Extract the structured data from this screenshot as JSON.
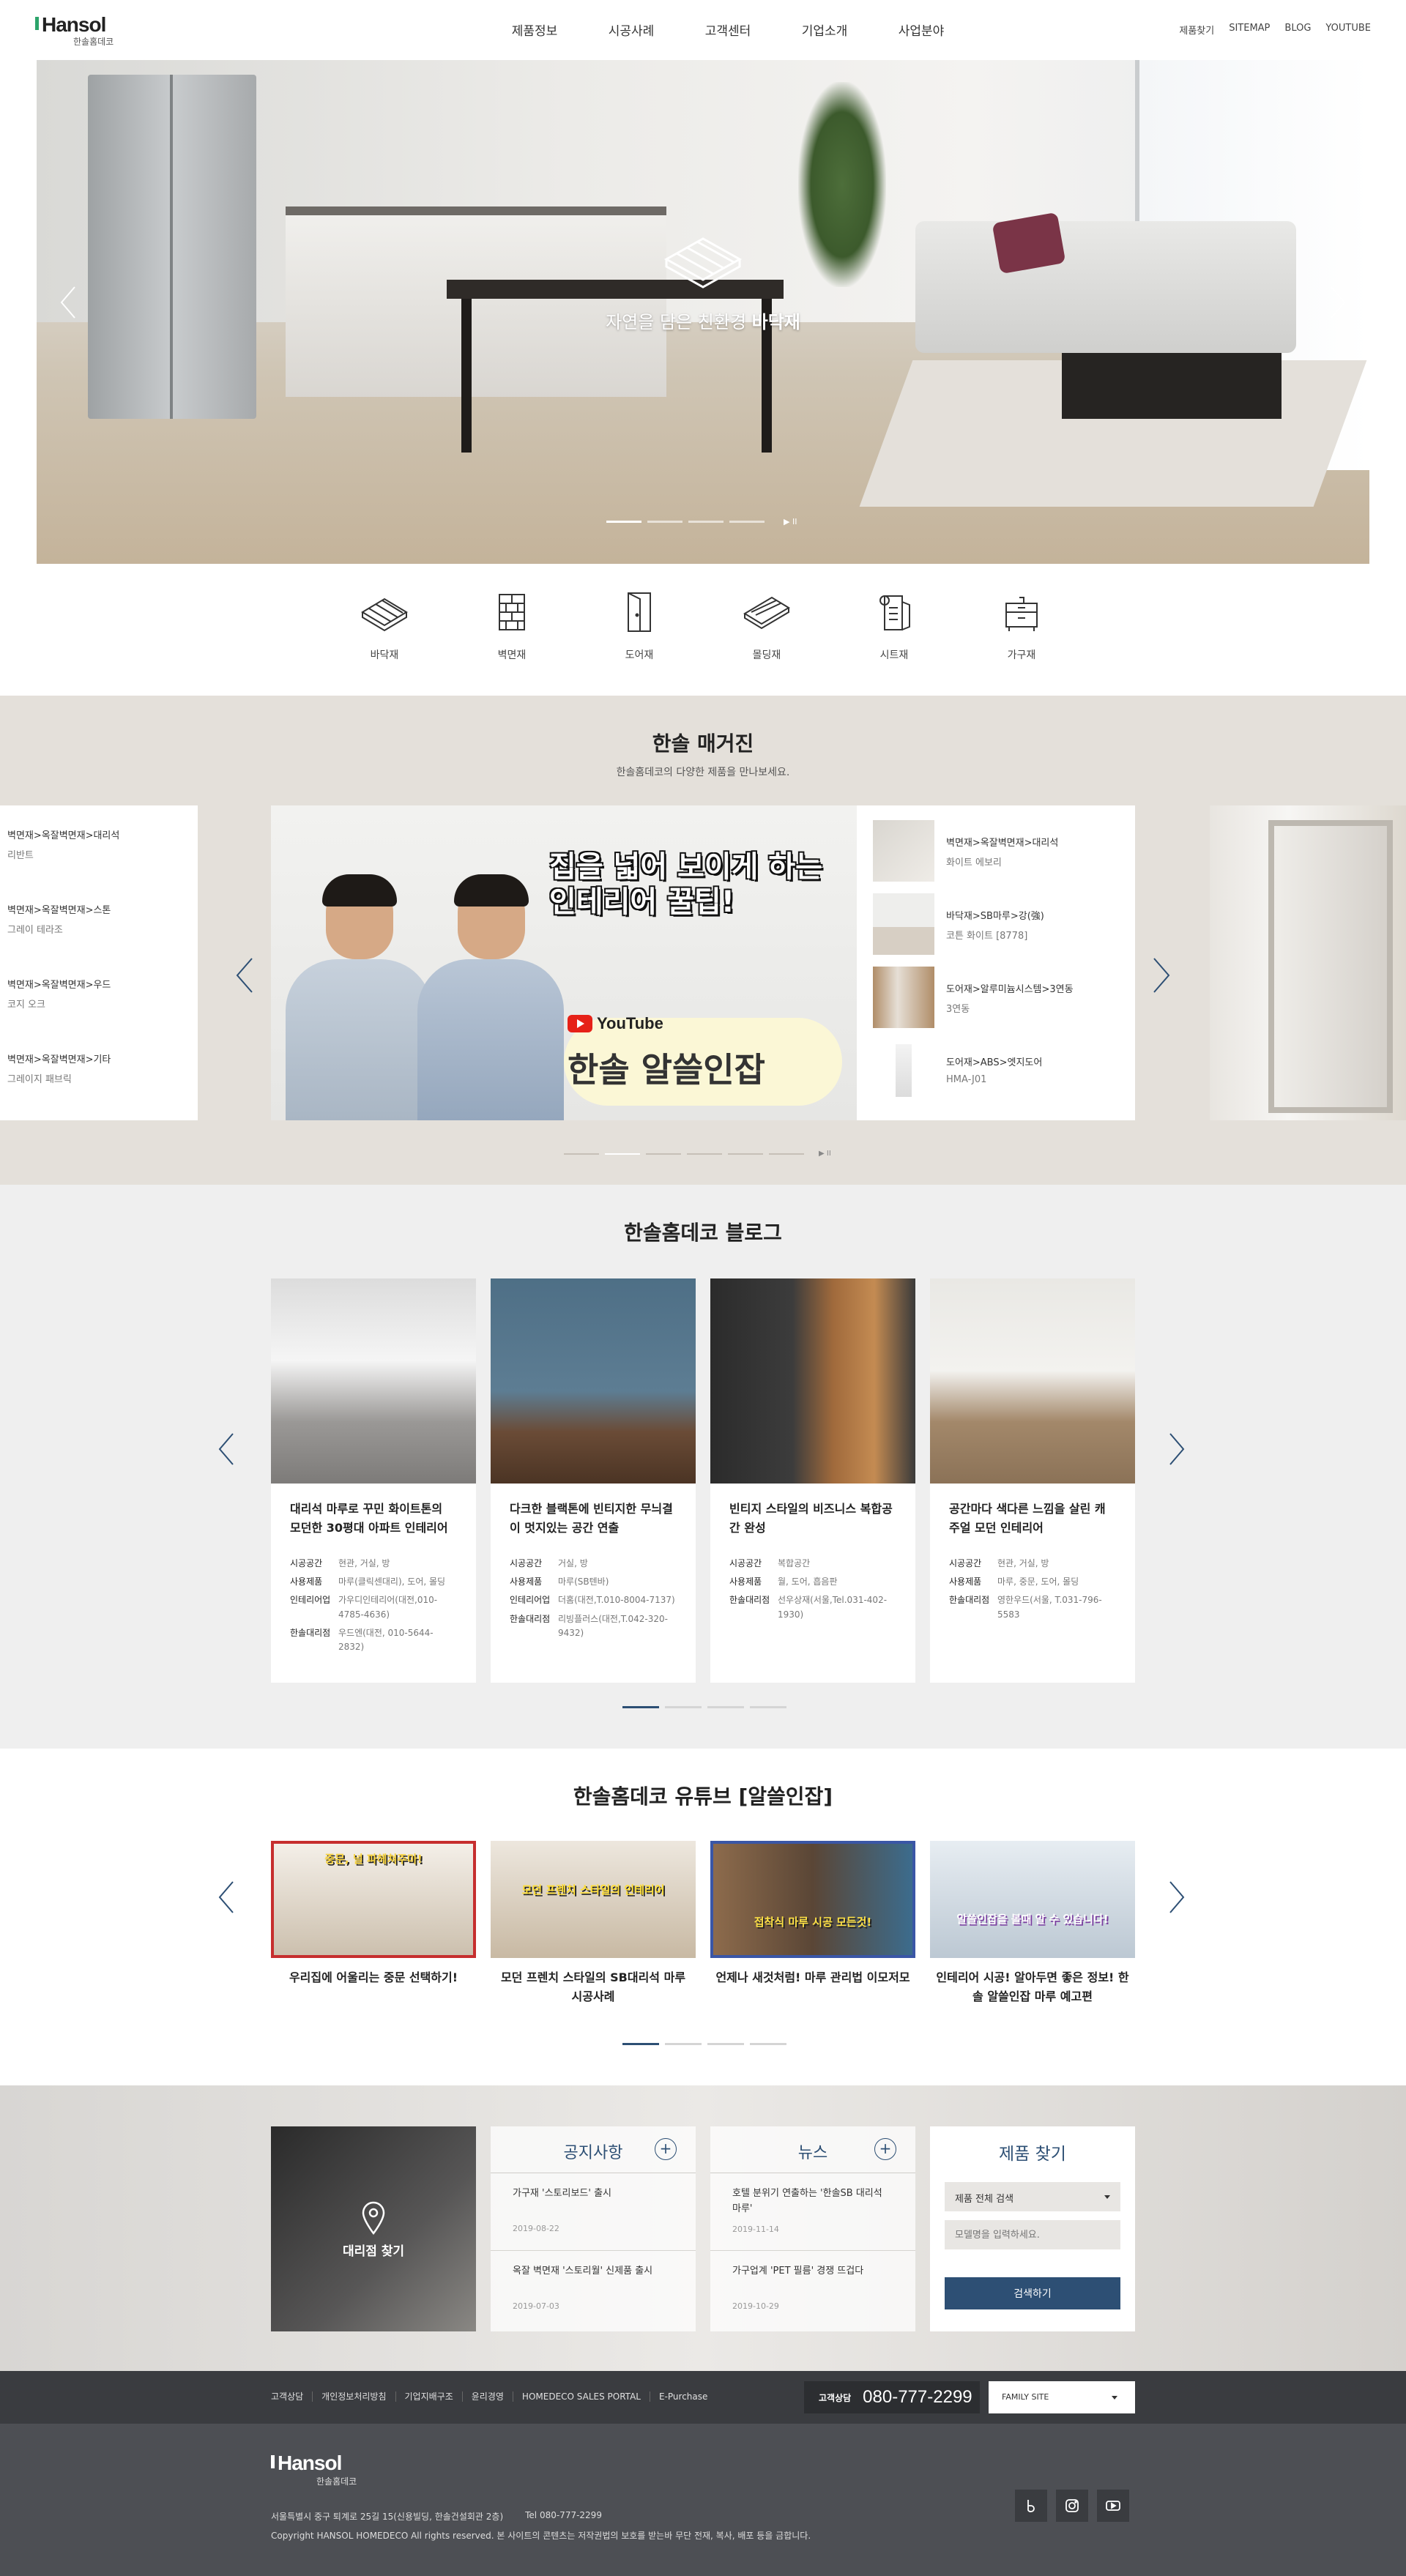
{
  "header": {
    "logo": "Hansol",
    "logo_sub": "한솔홈데코",
    "nav": [
      "제품정보",
      "시공사례",
      "고객센터",
      "기업소개",
      "사업분야"
    ],
    "util": [
      "제품찾기",
      "SITEMAP",
      "BLOG",
      "YOUTUBE"
    ]
  },
  "hero": {
    "text_prefix": "자연을 담은 친환경",
    "text_bold": "바닥재",
    "pause_symbol": "▶ II"
  },
  "categories": [
    {
      "label": "바닥재",
      "icon": "floor-icon"
    },
    {
      "label": "벽면재",
      "icon": "wall-icon"
    },
    {
      "label": "도어재",
      "icon": "door-icon"
    },
    {
      "label": "몰딩재",
      "icon": "molding-icon"
    },
    {
      "label": "시트재",
      "icon": "sheet-icon"
    },
    {
      "label": "가구재",
      "icon": "furniture-icon"
    }
  ],
  "magazine": {
    "title": "한솔 매거진",
    "subtitle": "한솔홈데코의 다양한 제품을 만나보세요.",
    "left_items": [
      {
        "category": "벽면재>옥잘벽면재>대리석",
        "name": "리반트"
      },
      {
        "category": "벽면재>옥잘벽면재>스톤",
        "name": "그레이 테라조"
      },
      {
        "category": "벽면재>옥잘벽면재>우드",
        "name": "코지 오크"
      },
      {
        "category": "벽면재>옥잘벽면재>기타",
        "name": "그레이지 패브릭"
      }
    ],
    "feature": {
      "headline_line1": "집을 넓어 보이게 하는",
      "headline_line2": "인테리어 꿀팁!",
      "yt_word": "YouTube",
      "channel": "한솔 알쓸인잡"
    },
    "right_items": [
      {
        "category": "벽면재>옥잘벽면재>대리석",
        "name": "화이트 에보리"
      },
      {
        "category": "바닥재>SB마루>강(強)",
        "name": "코튼 화이트 [8778]"
      },
      {
        "category": "도어재>알루미늄시스템>3연동",
        "name": "3연동"
      },
      {
        "category": "도어재>ABS>엣지도어",
        "name": "HMA-J01"
      }
    ],
    "pause_symbol": "▶ II"
  },
  "blog": {
    "title": "한솔홈데코 블로그",
    "cards": [
      {
        "title": "대리석 마루로 꾸민 화이트톤의 모던한 30평대 아파트 인테리어",
        "rows": [
          {
            "k": "시공공간",
            "v": "현관, 거실, 방"
          },
          {
            "k": "사용제품",
            "v": "마루(클릭센대리), 도어, 몰딩"
          },
          {
            "k": "인테리어업",
            "v": "가우디인테리어(대전,010-4785-4636)"
          },
          {
            "k": "한솔대리점",
            "v": "우드엔(대전, 010-5644-2832)"
          }
        ]
      },
      {
        "title": "다크한 블랙톤에 빈티지한 무늬결이 멋지있는 공간 연출",
        "rows": [
          {
            "k": "시공공간",
            "v": "거실, 방"
          },
          {
            "k": "사용제품",
            "v": "마루(SB텐바)"
          },
          {
            "k": "인테리어업",
            "v": "더홈(대전,T.010-8004-7137)"
          },
          {
            "k": "한솔대리점",
            "v": "리빙플러스(대전,T.042-320-9432)"
          }
        ]
      },
      {
        "title": "빈티지 스타일의 비즈니스 복합공간 완성",
        "rows": [
          {
            "k": "시공공간",
            "v": "복합공간"
          },
          {
            "k": "사용제품",
            "v": "월, 도어, 흡음판"
          },
          {
            "k": "한솔대리점",
            "v": "선우상재(서울,Tel.031-402-1930)"
          }
        ]
      },
      {
        "title": "공간마다 색다른 느낌을 살린 캐주얼 모던 인테리어",
        "rows": [
          {
            "k": "시공공간",
            "v": "현관, 거실, 방"
          },
          {
            "k": "사용제품",
            "v": "마루, 중문, 도어, 몰딩"
          },
          {
            "k": "한솔대리점",
            "v": "영한우드(서울, T.031-796-5583"
          }
        ]
      }
    ]
  },
  "youtube": {
    "title": "한솔홈데코 유튜브 [알쓸인잡]",
    "cards": [
      {
        "tag": "중문, 널 파헤쳐주마!",
        "caption": "우리집에 어울리는 중문 선택하기!",
        "border": "#c62e2e"
      },
      {
        "tag": "모던 프렌치 스타일의 인테리어",
        "caption": "모던 프렌치 스타일의 SB대리석 마루 시공사례",
        "border": "#ffffff"
      },
      {
        "tag": "접착식 마루 시공 모든것!",
        "caption": "언제나 새것처럼! 마루 관리법 이모저모",
        "border": "#3a56a6"
      },
      {
        "tag": "알쓸인잡을 볼때 알 수 있습니다!",
        "caption": "인테리어 시공! 알아두면 좋은 정보! 한솔 알쓸인잡 마루 예고편",
        "border": "#ffffff"
      }
    ]
  },
  "info": {
    "dealer": "대리점 찾기",
    "notice": {
      "title": "공지사항",
      "plus": "+",
      "items": [
        {
          "title": "가구재 '스토리보드' 출시",
          "date": "2019-08-22"
        },
        {
          "title": "옥잘 벽면재 '스토리월' 신제품 출시",
          "date": "2019-07-03"
        }
      ]
    },
    "news": {
      "title": "뉴스",
      "plus": "+",
      "items": [
        {
          "title": "호텔 분위기 연출하는 '한솔SB 대리석 마루'",
          "date": "2019-11-14"
        },
        {
          "title": "가구업계 'PET 필름' 경쟁 뜨겁다",
          "date": "2019-10-29"
        }
      ]
    },
    "finder": {
      "title": "제품 찾기",
      "select": "제품 전체 검색",
      "placeholder": "모델명을 입력하세요.",
      "button": "검색하기"
    }
  },
  "footer_bar": {
    "links": [
      "고객상담",
      "개인정보처리방침",
      "기업지배구조",
      "윤리경영",
      "HOMEDECO SALES PORTAL",
      "E-Purchase"
    ],
    "cs_label": "고객상담",
    "cs_phone": "080-777-2299",
    "family": "FAMILY SITE"
  },
  "footer": {
    "logo": "Hansol",
    "logo_sub": "한솔홈데코",
    "address": "서울특별시 중구 퇴계로 25길 15(신용빌딩, 한솔건설회관 2층)",
    "tel": "Tel 080-777-2299",
    "copyright": "Copyright HANSOL HOMEDECO All rights reserved. 본 사이트의 콘텐츠는 저작권법의 보호를 받는바 무단 전재, 복사, 배포 등을 금합니다."
  }
}
